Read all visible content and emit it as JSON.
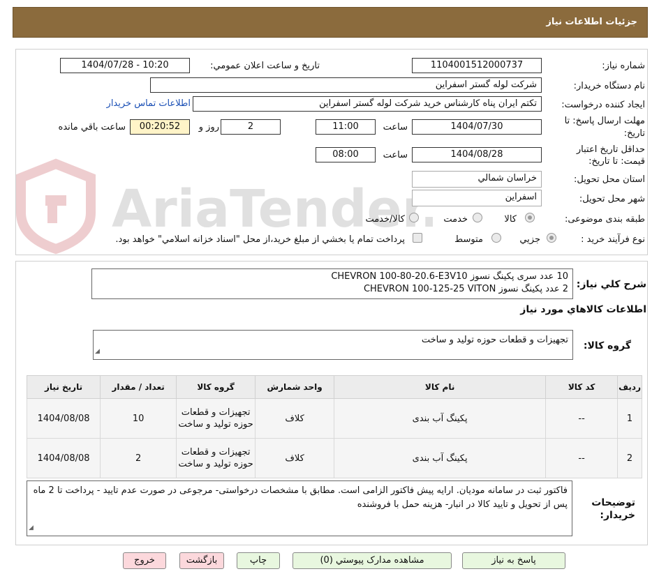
{
  "header": {
    "title": "جزئیات اطلاعات نیاز"
  },
  "form": {
    "need_number_label": "شماره نیاز:",
    "need_number": "1104001512000737",
    "announce_label": "تاریخ و ساعت اعلان عمومي:",
    "announce_value": "1404/07/28 - 10:20",
    "buyer_org_label": "نام دستگاه خريدار:",
    "buyer_org": "شرکت لوله گستر اسفراين",
    "requester_label": "ايجاد کننده درخواست:",
    "requester": "تکتم ایران پناه کارشناس خرید شرکت لوله گستر اسفراين",
    "contact_link": "اطلاعات تماس خريدار",
    "deadline_label_1": "مهلت ارسال پاسخ: تا",
    "deadline_label_2": "تاريخ:",
    "deadline_date": "1404/07/30",
    "time_label": "ساعت",
    "deadline_time": "11:00",
    "days": "2",
    "days_label": "روز و",
    "remaining": "00:20:52",
    "remaining_label": "ساعت باقي مانده",
    "validity_label_1": "حداقل تاريخ اعتبار",
    "validity_label_2": "قيمت: تا تاريخ:",
    "validity_date": "1404/08/28",
    "validity_time": "08:00",
    "province_label": "استان محل تحويل:",
    "province": "خراسان شمالي",
    "city_label": "شهر محل تحويل:",
    "city": "اسفراين",
    "category_label": "طبقه بندی موضوعی:",
    "category_options": [
      "کالا",
      "خدمت",
      "کالا/خدمت"
    ],
    "category_selected": "کالا",
    "process_label": "نوع فرآيند خريد :",
    "process_options": [
      "جزيي",
      "متوسط"
    ],
    "process_selected": "جزيي",
    "payment_note": "پرداخت تمام يا بخشي از مبلغ خريد،از محل \"اسناد خزانه اسلامي\" خواهد بود."
  },
  "watermark": "AriaTender.neT",
  "description": {
    "label": "شرح کلي نياز:",
    "line1": "10 عدد سری پکینگ نسوز CHEVRON 100-80-20.6-E3V10",
    "line2": "2 عدد        پکینگ نسوز CHEVRON 100-125-25 VITON"
  },
  "goods": {
    "section_title": "اطلاعات کالاهاي مورد نياز",
    "group_label": "گروه کالا:",
    "group_value": "تجهیزات و قطعات حوزه تولید و ساخت",
    "columns": [
      "رديف",
      "کد کالا",
      "نام کالا",
      "واحد شمارش",
      "گروه کالا",
      "تعداد / مقدار",
      "تاريخ نياز"
    ],
    "rows": [
      {
        "row": "1",
        "code": "--",
        "name": "پکینگ آب بندی",
        "unit": "کلاف",
        "group": "تجهیزات و قطعات حوزه تولید و ساخت",
        "qty": "10",
        "date": "1404/08/08"
      },
      {
        "row": "2",
        "code": "--",
        "name": "پکینگ آب بندی",
        "unit": "کلاف",
        "group": "تجهیزات و قطعات حوزه تولید و ساخت",
        "qty": "2",
        "date": "1404/08/08"
      }
    ]
  },
  "notes": {
    "label_1": "توضيحات",
    "label_2": "خريدار:",
    "text": "فاکتور ثبت در سامانه مودیان. ارایه پیش فاکتور الزامی است. مطابق با مشخصات درخواستی- مرجوعی در صورت عدم تایید - پرداخت تا 2 ماه پس از تحویل و تایید کالا در انبار- هزینه حمل با فروشنده"
  },
  "buttons": {
    "reply": "پاسخ به نياز",
    "attachments": "مشاهده مدارک پيوستي (0)",
    "print": "چاپ",
    "back": "بازگشت",
    "exit": "خروج"
  },
  "colors": {
    "header": "#8B6B3D",
    "link": "#1a4fb5",
    "remaining_bg": "#FFF4C8",
    "button_green": "#e8f7df",
    "button_pink": "#fcd8dc"
  }
}
